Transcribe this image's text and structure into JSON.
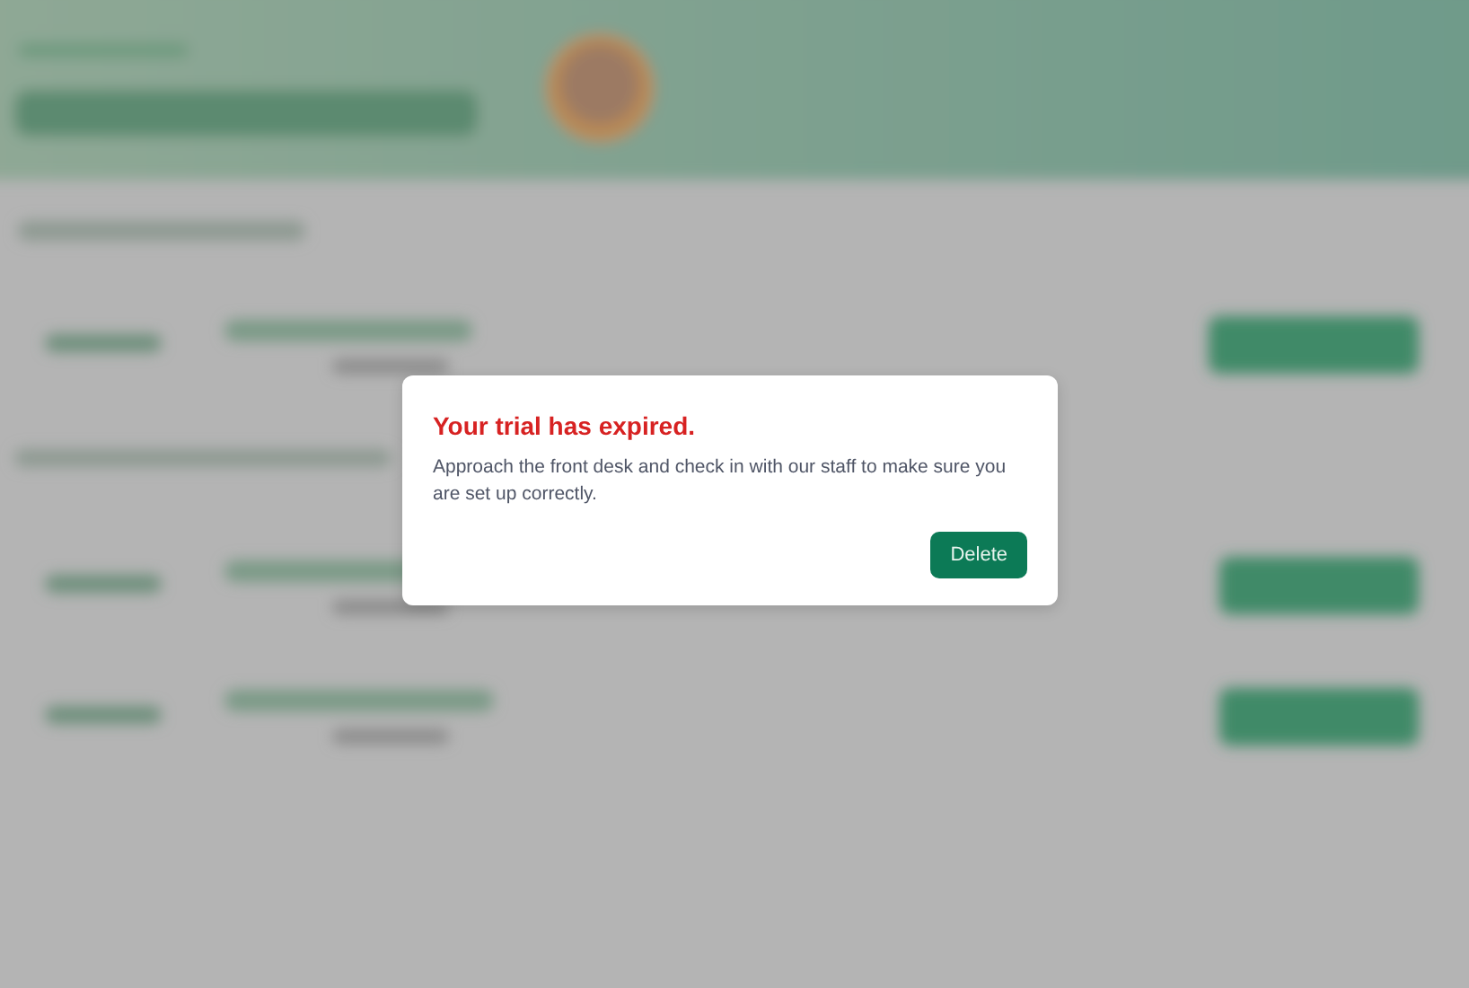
{
  "dialog": {
    "title": "Your trial has expired.",
    "message": "Approach the front desk and check in with our staff to make sure you are set up correctly.",
    "buttons": [
      {
        "label": "Delete",
        "kind": "primary"
      }
    ]
  }
}
